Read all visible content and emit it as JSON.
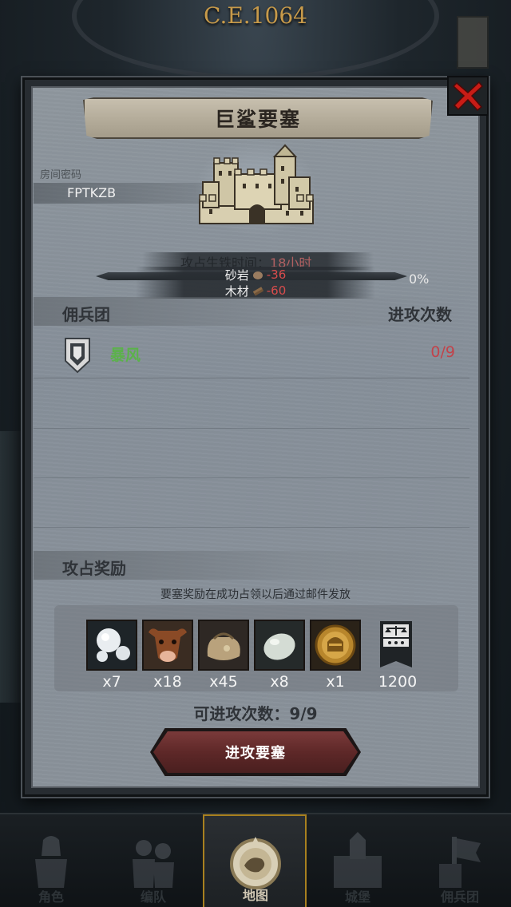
{
  "header": {
    "era": "C.E.1064"
  },
  "dialog": {
    "title": "巨鲨要塞",
    "room_code_label": "房间密码",
    "room_code": "FPTKZB",
    "capture": {
      "time_label": "攻占生铁时间",
      "time_value": "18小时",
      "progress_percent": 0,
      "progress_text": "0%"
    },
    "resources": [
      {
        "name": "砂岩",
        "icon": "stone-icon",
        "value": "-36"
      },
      {
        "name": "木材",
        "icon": "wood-icon",
        "value": "-60"
      }
    ],
    "mercenary_section": {
      "title": "佣兵团",
      "right_title": "进攻次数",
      "rows": [
        {
          "name": "暴风",
          "count": "0/9",
          "icon": "shield-icon"
        }
      ]
    },
    "reward_section": {
      "title": "攻占奖励",
      "note": "要塞奖励在成功占领以后通过邮件发放",
      "items": [
        {
          "icon": "pearl-icon",
          "qty": "x7"
        },
        {
          "icon": "cow-icon",
          "qty": "x18"
        },
        {
          "icon": "sack-icon",
          "qty": "x45"
        },
        {
          "icon": "stone-egg-icon",
          "qty": "x8"
        },
        {
          "icon": "knight-coin-icon",
          "qty": "x1"
        }
      ],
      "rank": {
        "icon": "scales-banner-icon",
        "value": "1200"
      }
    },
    "attack_count_label": "可进攻次数：",
    "attack_count_value": "9/9",
    "attack_button": "进攻要塞"
  },
  "nav": [
    {
      "label": "角色",
      "icon": "knight-icon",
      "active": false
    },
    {
      "label": "编队",
      "icon": "army-icon",
      "active": false
    },
    {
      "label": "地图",
      "icon": "map-compass-icon",
      "active": true
    },
    {
      "label": "城堡",
      "icon": "castle-icon",
      "active": false
    },
    {
      "label": "佣兵团",
      "icon": "mercenary-icon",
      "active": false
    }
  ],
  "colors": {
    "accent_gold": "#a8801f",
    "negative": "#d84c4c",
    "guild_name": "#5bb24a",
    "attack_button": "#5e2828"
  }
}
